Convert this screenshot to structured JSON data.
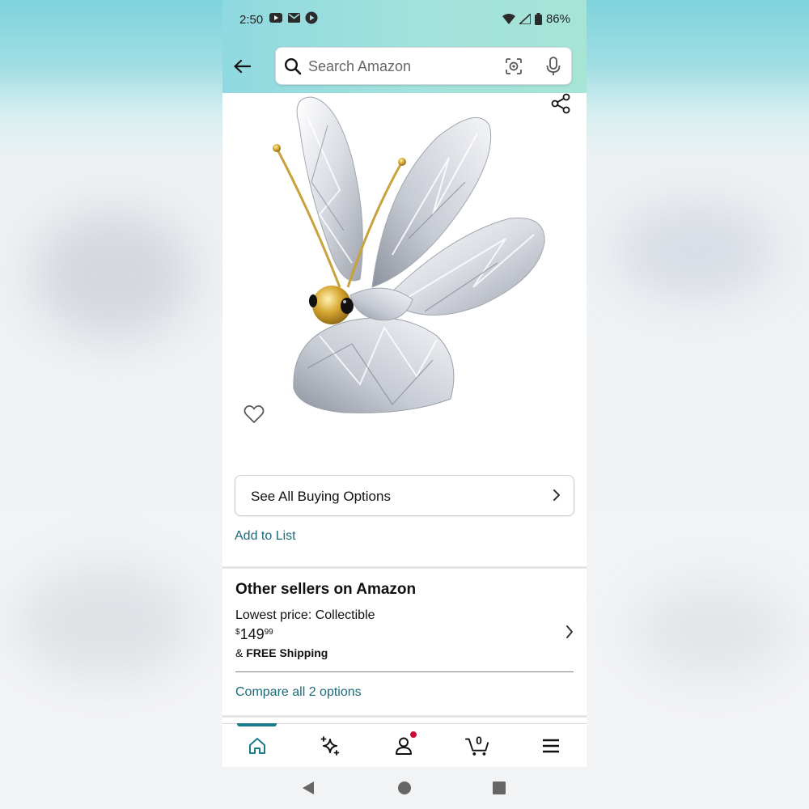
{
  "status_bar": {
    "time": "2:50",
    "battery": "86%",
    "notif_icons": [
      "youtube-icon",
      "mail-icon",
      "play-icon"
    ]
  },
  "search": {
    "placeholder": "Search Amazon"
  },
  "product": {
    "image_alt": "Crystal butterfly figurine"
  },
  "buy_options_label": "See All Buying Options",
  "add_to_list_label": "Add to List",
  "other_sellers": {
    "title": "Other sellers on Amazon",
    "lowest_price_label": "Lowest price: Collectible",
    "price_symbol": "$",
    "price_whole": "149",
    "price_fraction": "99",
    "shipping_prefix": "& ",
    "shipping_bold": "FREE Shipping",
    "compare_label": "Compare all 2 options"
  },
  "bottom_nav": {
    "items": [
      "home-icon",
      "sparkle-icon",
      "account-icon",
      "cart-icon",
      "menu-icon"
    ],
    "cart_count": "0",
    "active": "home"
  },
  "colors": {
    "link": "#1b6a7a",
    "accent": "#1d7a8c",
    "badge": "#cc0c39",
    "header_gradient_start": "#8fd9e0",
    "header_gradient_end": "#a6e4d6"
  }
}
